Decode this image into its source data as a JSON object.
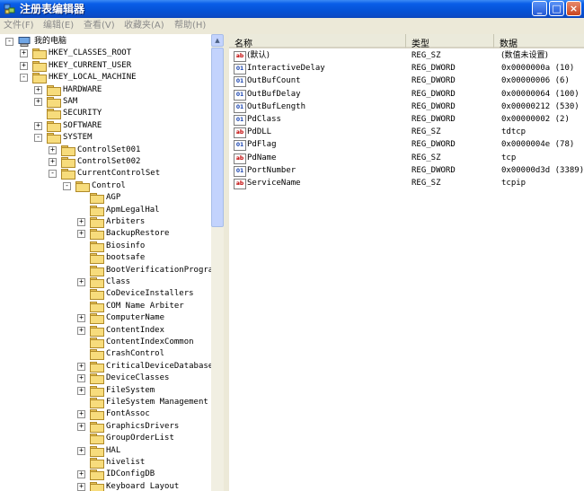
{
  "window": {
    "title": "注册表编辑器"
  },
  "menu": [
    "文件(F)",
    "编辑(E)",
    "查看(V)",
    "收藏夹(A)",
    "帮助(H)"
  ],
  "tree": [
    {
      "label": "我的电脑",
      "depth": 0,
      "exp": "-",
      "icon": "computer"
    },
    {
      "label": "HKEY_CLASSES_ROOT",
      "depth": 1,
      "exp": "+"
    },
    {
      "label": "HKEY_CURRENT_USER",
      "depth": 1,
      "exp": "+"
    },
    {
      "label": "HKEY_LOCAL_MACHINE",
      "depth": 1,
      "exp": "-"
    },
    {
      "label": "HARDWARE",
      "depth": 2,
      "exp": "+"
    },
    {
      "label": "SAM",
      "depth": 2,
      "exp": "+"
    },
    {
      "label": "SECURITY",
      "depth": 2,
      "exp": ""
    },
    {
      "label": "SOFTWARE",
      "depth": 2,
      "exp": "+"
    },
    {
      "label": "SYSTEM",
      "depth": 2,
      "exp": "-"
    },
    {
      "label": "ControlSet001",
      "depth": 3,
      "exp": "+"
    },
    {
      "label": "ControlSet002",
      "depth": 3,
      "exp": "+"
    },
    {
      "label": "CurrentControlSet",
      "depth": 3,
      "exp": "-"
    },
    {
      "label": "Control",
      "depth": 4,
      "exp": "-"
    },
    {
      "label": "AGP",
      "depth": 5,
      "exp": ""
    },
    {
      "label": "ApmLegalHal",
      "depth": 5,
      "exp": ""
    },
    {
      "label": "Arbiters",
      "depth": 5,
      "exp": "+"
    },
    {
      "label": "BackupRestore",
      "depth": 5,
      "exp": "+"
    },
    {
      "label": "Biosinfo",
      "depth": 5,
      "exp": ""
    },
    {
      "label": "bootsafe",
      "depth": 5,
      "exp": ""
    },
    {
      "label": "BootVerificationProgram",
      "depth": 5,
      "exp": ""
    },
    {
      "label": "Class",
      "depth": 5,
      "exp": "+"
    },
    {
      "label": "CoDeviceInstallers",
      "depth": 5,
      "exp": ""
    },
    {
      "label": "COM Name Arbiter",
      "depth": 5,
      "exp": ""
    },
    {
      "label": "ComputerName",
      "depth": 5,
      "exp": "+"
    },
    {
      "label": "ContentIndex",
      "depth": 5,
      "exp": "+"
    },
    {
      "label": "ContentIndexCommon",
      "depth": 5,
      "exp": ""
    },
    {
      "label": "CrashControl",
      "depth": 5,
      "exp": ""
    },
    {
      "label": "CriticalDeviceDatabase",
      "depth": 5,
      "exp": "+"
    },
    {
      "label": "DeviceClasses",
      "depth": 5,
      "exp": "+"
    },
    {
      "label": "FileSystem",
      "depth": 5,
      "exp": "+"
    },
    {
      "label": "FileSystem Management",
      "depth": 5,
      "exp": ""
    },
    {
      "label": "FontAssoc",
      "depth": 5,
      "exp": "+"
    },
    {
      "label": "GraphicsDrivers",
      "depth": 5,
      "exp": "+"
    },
    {
      "label": "GroupOrderList",
      "depth": 5,
      "exp": ""
    },
    {
      "label": "HAL",
      "depth": 5,
      "exp": "+"
    },
    {
      "label": "hivelist",
      "depth": 5,
      "exp": ""
    },
    {
      "label": "IDConfigDB",
      "depth": 5,
      "exp": "+"
    },
    {
      "label": "Keyboard Layout",
      "depth": 5,
      "exp": "+"
    }
  ],
  "columns": {
    "name": "名称",
    "type": "类型",
    "data": "数据"
  },
  "values": [
    {
      "name": "(默认)",
      "type": "REG_SZ",
      "data": "(数值未设置)",
      "kind": "sz"
    },
    {
      "name": "InteractiveDelay",
      "type": "REG_DWORD",
      "data": "0x0000000a (10)",
      "kind": "dw"
    },
    {
      "name": "OutBufCount",
      "type": "REG_DWORD",
      "data": "0x00000006 (6)",
      "kind": "dw"
    },
    {
      "name": "OutBufDelay",
      "type": "REG_DWORD",
      "data": "0x00000064 (100)",
      "kind": "dw"
    },
    {
      "name": "OutBufLength",
      "type": "REG_DWORD",
      "data": "0x00000212 (530)",
      "kind": "dw"
    },
    {
      "name": "PdClass",
      "type": "REG_DWORD",
      "data": "0x00000002 (2)",
      "kind": "dw"
    },
    {
      "name": "PdDLL",
      "type": "REG_SZ",
      "data": "tdtcp",
      "kind": "sz"
    },
    {
      "name": "PdFlag",
      "type": "REG_DWORD",
      "data": "0x0000004e (78)",
      "kind": "dw"
    },
    {
      "name": "PdName",
      "type": "REG_SZ",
      "data": "tcp",
      "kind": "sz"
    },
    {
      "name": "PortNumber",
      "type": "REG_DWORD",
      "data": "0x00000d3d (3389)",
      "kind": "dw"
    },
    {
      "name": "ServiceName",
      "type": "REG_SZ",
      "data": "tcpip",
      "kind": "sz"
    }
  ]
}
